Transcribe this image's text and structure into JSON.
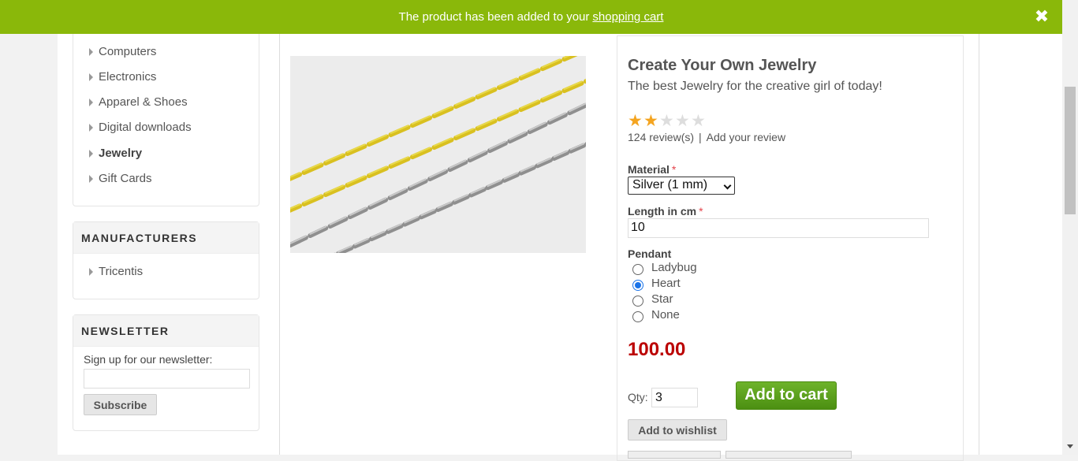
{
  "notification": {
    "text": "The product has been added to your",
    "link": "shopping cart",
    "close_icon": "close-icon"
  },
  "sidebar": {
    "categories": [
      {
        "label": "Computers"
      },
      {
        "label": "Electronics"
      },
      {
        "label": "Apparel & Shoes"
      },
      {
        "label": "Digital downloads"
      },
      {
        "label": "Jewelry",
        "active": true
      },
      {
        "label": "Gift Cards"
      }
    ],
    "manufacturers": {
      "title": "MANUFACTURERS",
      "items": [
        {
          "label": "Tricentis"
        }
      ]
    },
    "newsletter": {
      "title": "NEWSLETTER",
      "label": "Sign up for our newsletter:",
      "input_value": "",
      "button": "Subscribe"
    }
  },
  "product": {
    "title": "Create Your Own Jewelry",
    "description": "The best Jewelry for the creative girl of today!",
    "rating": {
      "value": 2,
      "max": 5
    },
    "reviews_count": "124 review(s)",
    "add_review": "Add your review",
    "material": {
      "label": "Material",
      "required_mark": "*",
      "selected": "Silver (1 mm)"
    },
    "length": {
      "label": "Length in cm",
      "required_mark": "*",
      "value": "10"
    },
    "pendant": {
      "label": "Pendant",
      "options": [
        {
          "label": "Ladybug",
          "checked": false
        },
        {
          "label": "Heart",
          "checked": true
        },
        {
          "label": "Star",
          "checked": false
        },
        {
          "label": "None",
          "checked": false
        }
      ]
    },
    "price": "100.00",
    "qty_label": "Qty:",
    "qty_value": "3",
    "add_to_cart": "Add to cart",
    "add_to_wishlist": "Add to wishlist"
  },
  "colors": {
    "notification_bg": "#8ab80a",
    "price": "#bb0000",
    "add_to_cart": "#5aa01e",
    "star_on": "#f4a420"
  }
}
